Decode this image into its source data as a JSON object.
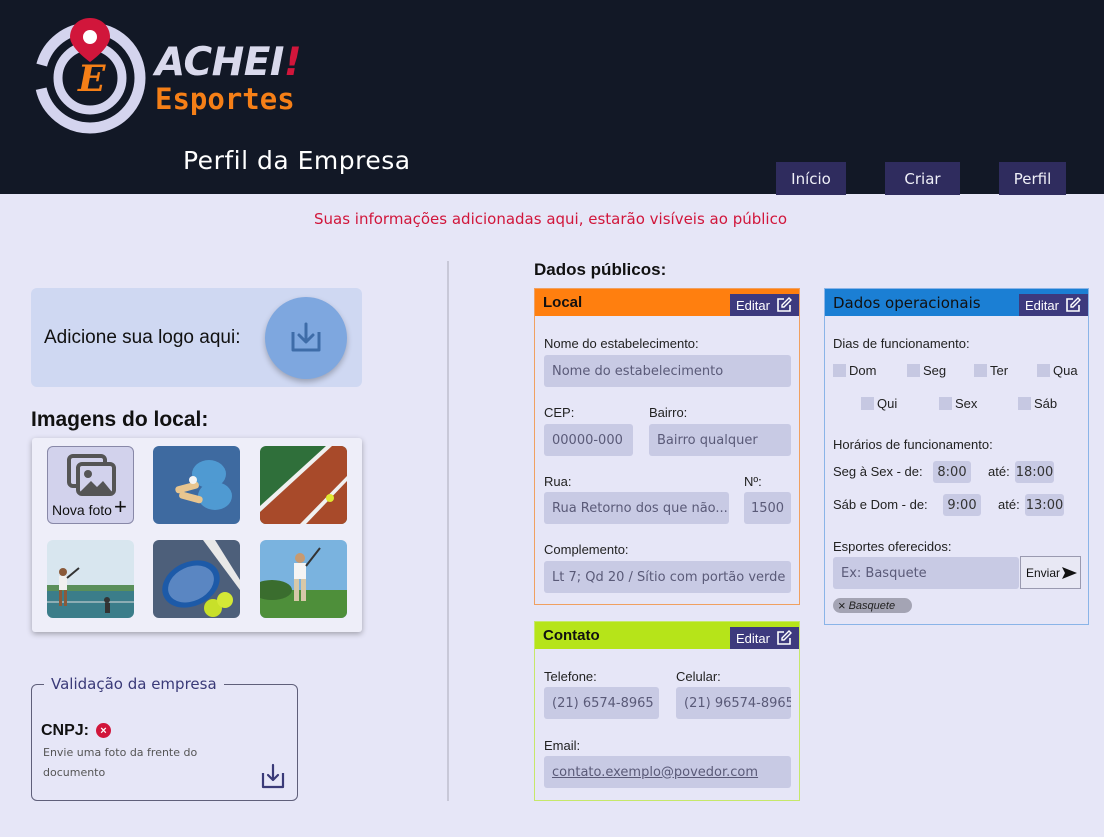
{
  "header": {
    "brand_line1": "ACHEI",
    "brand_bang": "!",
    "brand_line2": "Esportes",
    "logo_letter": "E",
    "page_title": "Perfil da Empresa",
    "nav": [
      "Início",
      "Criar",
      "Perfil"
    ]
  },
  "notice": "Suas informações adicionadas aqui, estarão visíveis ao público",
  "logo_upload": {
    "label": "Adicione sua logo aqui:"
  },
  "images": {
    "title": "Imagens do local:",
    "new_photo_label": "Nova foto",
    "new_photo_plus": "+"
  },
  "validation": {
    "legend": "Validação da empresa",
    "cnpj_label": "CNPJ:",
    "cnpj_status": "×",
    "help": "Envie uma foto da frente do documento"
  },
  "public_title": "Dados públicos:",
  "local": {
    "title": "Local",
    "edit": "Editar",
    "nome_label": "Nome do estabelecimento:",
    "nome_value": "Nome do estabelecimento",
    "cep_label": "CEP:",
    "cep_value": "00000-000",
    "bairro_label": "Bairro:",
    "bairro_value": "Bairro qualquer",
    "rua_label": "Rua:",
    "rua_value": "Rua Retorno dos que não...",
    "numero_label": "Nº:",
    "numero_value": "1500",
    "complemento_label": "Complemento:",
    "complemento_value": "Lt 7; Qd 20 / Sítio com portão verde"
  },
  "contato": {
    "title": "Contato",
    "edit": "Editar",
    "telefone_label": "Telefone:",
    "telefone_value": "(21) 6574-8965",
    "celular_label": "Celular:",
    "celular_value": "(21) 96574-8965",
    "email_label": "Email:",
    "email_value": "contato.exemplo@povedor.com"
  },
  "operacional": {
    "title": "Dados operacionais",
    "edit": "Editar",
    "dias_label": "Dias de funcionamento:",
    "dias": [
      "Dom",
      "Seg",
      "Ter",
      "Qua",
      "Qui",
      "Sex",
      "Sáb"
    ],
    "horarios_label": "Horários de funcionamento:",
    "semana_label": "Seg à Sex - de:",
    "semana_de": "8:00",
    "semana_ate_label": "até:",
    "semana_ate": "18:00",
    "fds_label": "Sáb e Dom - de:",
    "fds_de": "9:00",
    "fds_ate_label": "até:",
    "fds_ate": "13:00",
    "esportes_label": "Esportes oferecidos:",
    "esportes_placeholder": "Ex: Basquete",
    "send_label": "Enviar",
    "chip_label": "Basquete",
    "chip_x": "×"
  },
  "colors": {
    "header_bg": "#121826",
    "nav_bg": "#2f2c5e",
    "accent_red": "#d1163b",
    "brand_orange": "#f57f17",
    "local_header": "#ff7f0f",
    "contato_header": "#b6e419",
    "operacional_header": "#1b7fd4",
    "edit_bg": "#3d3a7e"
  }
}
